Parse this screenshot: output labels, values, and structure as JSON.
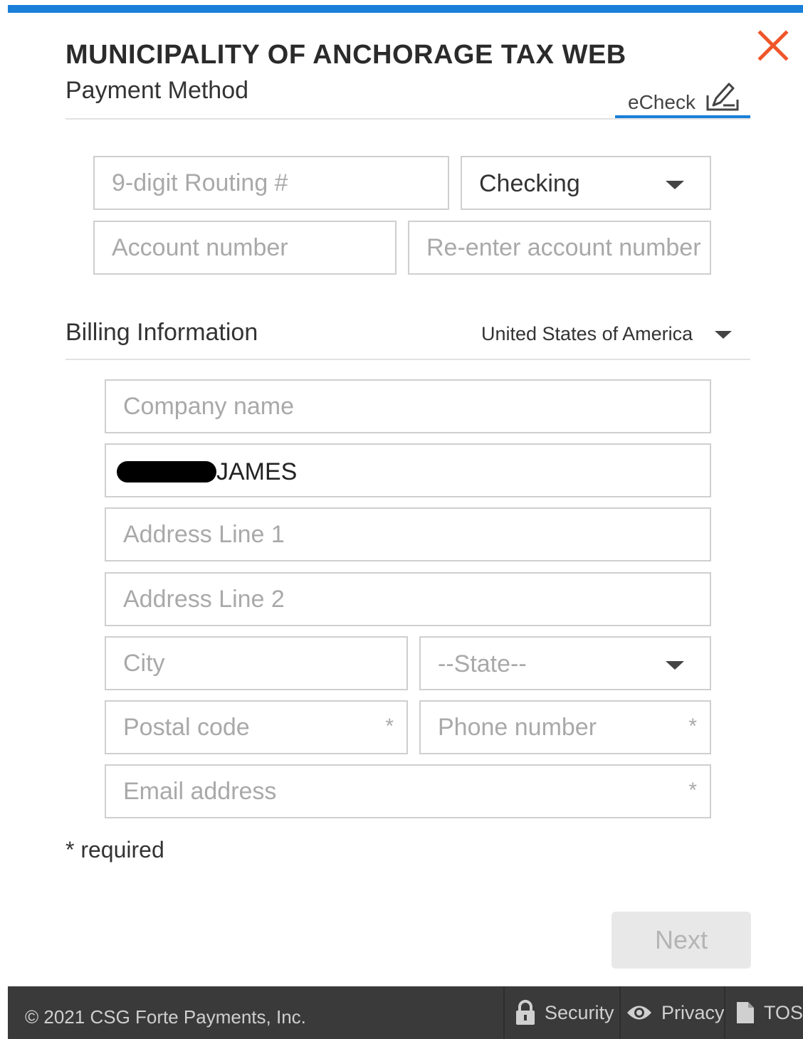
{
  "header": {
    "title": "MUNICIPALITY OF ANCHORAGE TAX WEB",
    "subtitle": "Payment Method",
    "tab_label": "eCheck"
  },
  "bank": {
    "routing_placeholder": "9-digit Routing #",
    "account_type": "Checking",
    "account_placeholder": "Account number",
    "reenter_placeholder": "Re-enter account number"
  },
  "billing": {
    "title": "Billing Information",
    "country": "United States of America",
    "company_placeholder": "Company name",
    "name_value": "JAMES",
    "address1_placeholder": "Address Line 1",
    "address2_placeholder": "Address Line 2",
    "city_placeholder": "City",
    "state_value": "--State--",
    "postal_placeholder": "Postal code",
    "phone_placeholder": "Phone number",
    "email_placeholder": "Email address",
    "required_marker": "*"
  },
  "required_note": "* required",
  "next_label": "Next",
  "footer": {
    "copyright": "© 2021 CSG Forte Payments, Inc.",
    "security": "Security",
    "privacy": "Privacy",
    "tos": "TOS"
  },
  "colors": {
    "accent": "#1a7fd9",
    "close": "#f0552a",
    "footer_bg": "#3a3a3a"
  }
}
